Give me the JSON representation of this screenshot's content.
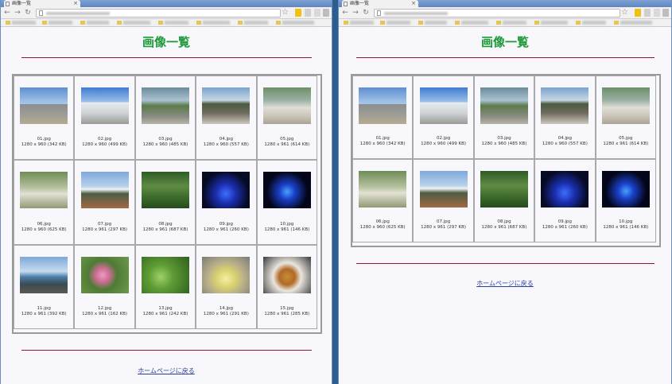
{
  "tab_title": "画像一覧",
  "page_title": "画像一覧",
  "home_link": "ホームページに戻る",
  "colors": {
    "title": "#1f9a3a",
    "rule": "#8b1a2e",
    "link": "#2a3fa0"
  },
  "images": [
    {
      "name": "01.jpg",
      "info": "1280 x 960 (342 KB)"
    },
    {
      "name": "02.jpg",
      "info": "1280 x 960 (499 KB)"
    },
    {
      "name": "03.jpg",
      "info": "1280 x 960 (485 KB)"
    },
    {
      "name": "04.jpg",
      "info": "1280 x 960 (557 KB)"
    },
    {
      "name": "05.jpg",
      "info": "1280 x 961 (614 KB)"
    },
    {
      "name": "06.jpg",
      "info": "1280 x 960 (625 KB)"
    },
    {
      "name": "07.jpg",
      "info": "1280 x 961 (297 KB)"
    },
    {
      "name": "08.jpg",
      "info": "1280 x 961 (687 KB)"
    },
    {
      "name": "09.jpg",
      "info": "1280 x 961 (260 KB)"
    },
    {
      "name": "10.jpg",
      "info": "1280 x 961 (146 KB)"
    },
    {
      "name": "11.jpg",
      "info": "1280 x 961 (392 KB)"
    },
    {
      "name": "12.jpg",
      "info": "1280 x 961 (162 KB)"
    },
    {
      "name": "13.jpg",
      "info": "1280 x 961 (242 KB)"
    },
    {
      "name": "14.jpg",
      "info": "1280 x 961 (291 KB)"
    },
    {
      "name": "15.jpg",
      "info": "1280 x 961 (285 KB)"
    }
  ]
}
